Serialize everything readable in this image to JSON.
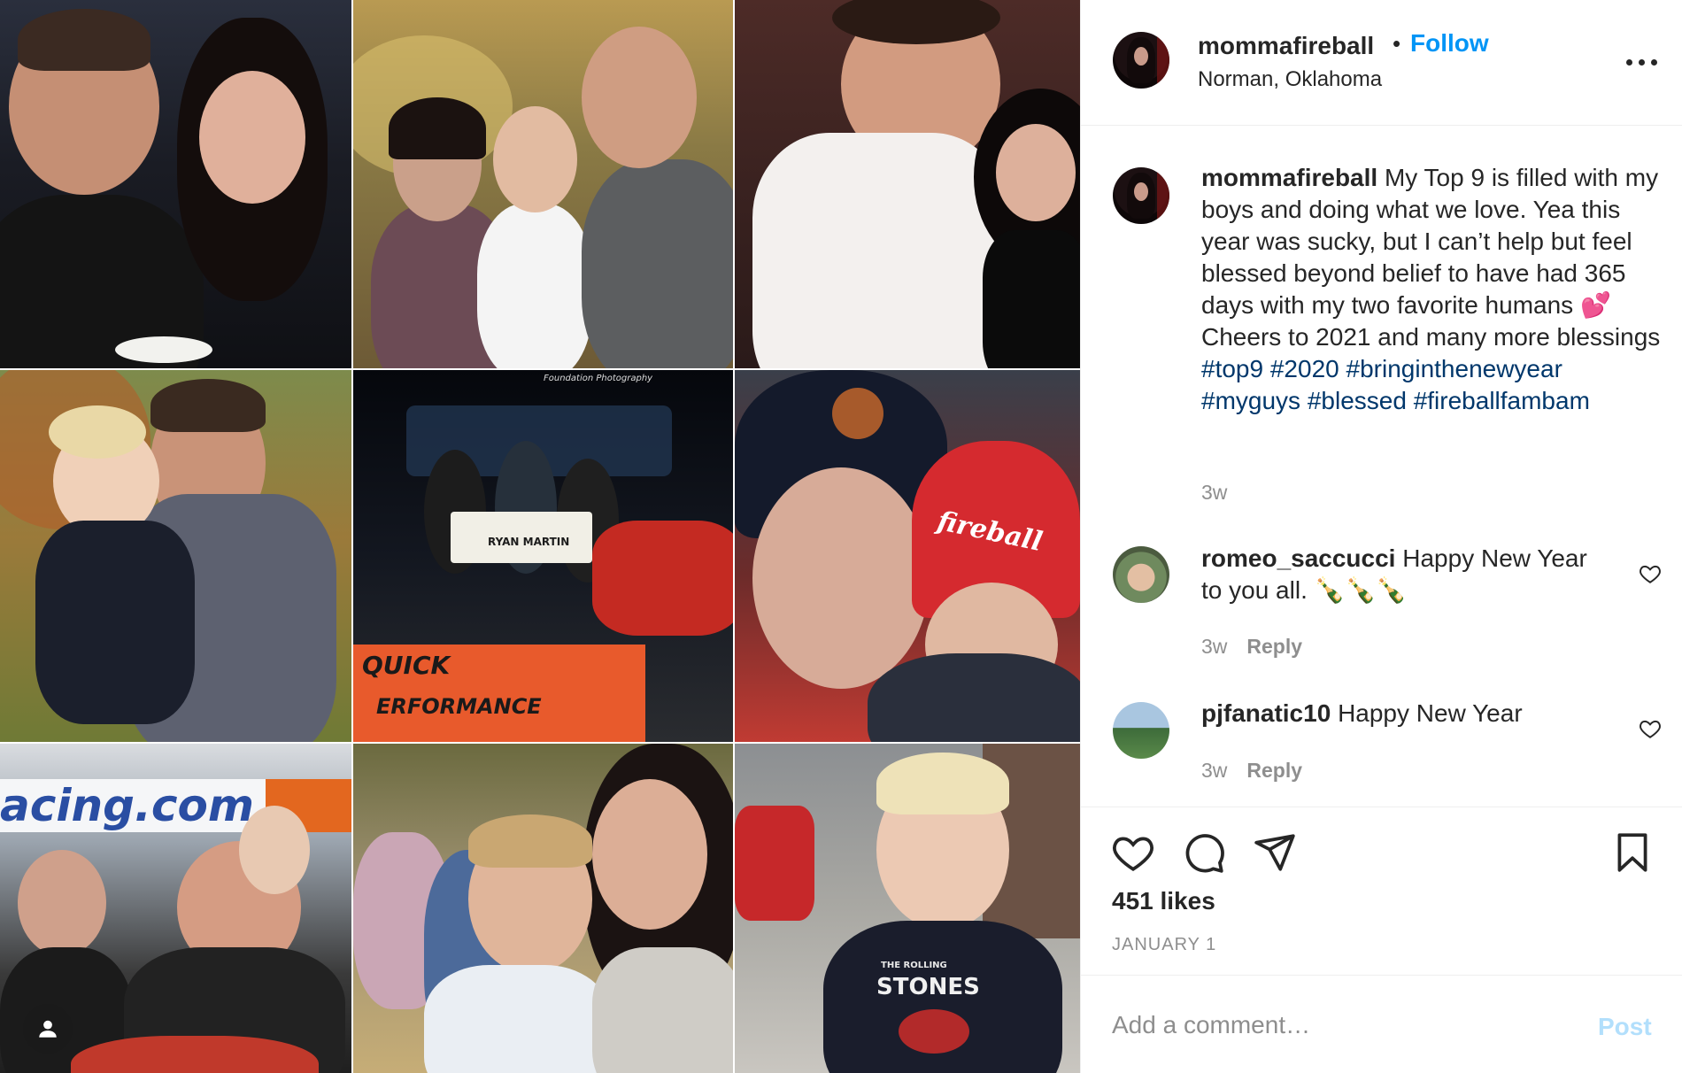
{
  "post": {
    "author": "mommafireball",
    "follow_label": "Follow",
    "separator": "•",
    "location": "Norman, Oklahoma",
    "more_label": "More options"
  },
  "caption": {
    "username": "mommafireball",
    "text_before": "My Top 9 is filled with my boys and doing what we love. Yea this year was sucky, but I can’t help but feel blessed beyond belief to have had 365 days with my two favorite humans 💕 Cheers to 2021 and many more blessings",
    "hashtags": [
      "#top9",
      "#2020",
      "#bringinthenewyear",
      "#myguys",
      "#blessed",
      "#fireballfambam"
    ],
    "time": "3w"
  },
  "comments": [
    {
      "username": "romeo_saccucci",
      "text": "Happy New Year to you all. 🍾🍾🍾",
      "time": "3w",
      "reply_label": "Reply"
    },
    {
      "username": "pjfanatic10",
      "text": "Happy New Year",
      "time": "3w",
      "reply_label": "Reply"
    }
  ],
  "footer": {
    "likes": "451 likes",
    "date": "JANUARY 1"
  },
  "add_comment": {
    "placeholder": "Add a comment…",
    "post_label": "Post"
  },
  "media": {
    "photo_texts": {
      "banner_quick": "QUICK",
      "banner_performance": "ERFORMANCE",
      "banner_bg_letters": "acing.com",
      "beanie_brand": "fireball",
      "shirt_brand": "STONES",
      "shirt_top": "THE ROLLING",
      "check_name": "RYAN MARTIN",
      "photographer": "Foundation Photography"
    }
  },
  "colors": {
    "accent": "#0095f6",
    "hashtag": "#00376b",
    "muted": "#8e8e8e",
    "post_disabled": "#b2dffc"
  }
}
